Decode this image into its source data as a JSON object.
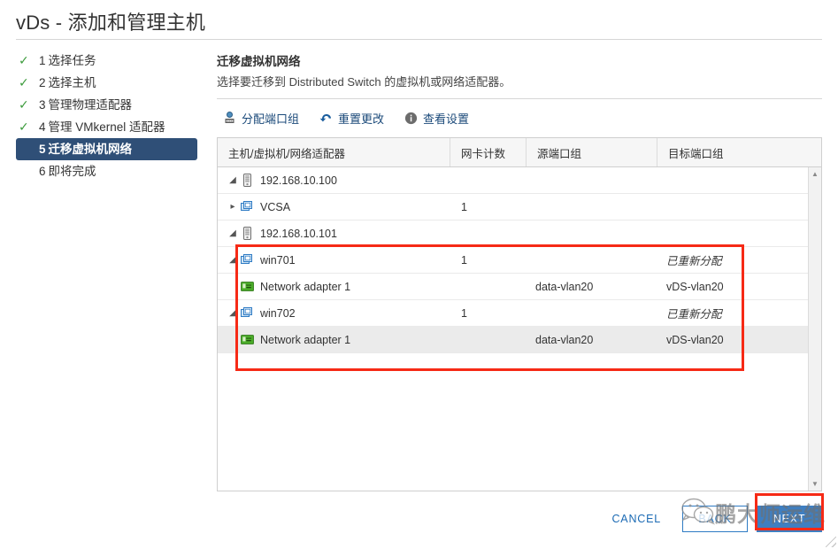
{
  "window": {
    "title": "vDs - 添加和管理主机"
  },
  "steps": [
    {
      "num": "1",
      "label": "选择任务",
      "done": true,
      "active": false
    },
    {
      "num": "2",
      "label": "选择主机",
      "done": true,
      "active": false
    },
    {
      "num": "3",
      "label": "管理物理适配器",
      "done": true,
      "active": false
    },
    {
      "num": "4",
      "label": "管理 VMkernel 适配器",
      "done": true,
      "active": false
    },
    {
      "num": "5",
      "label": "迁移虚拟机网络",
      "done": false,
      "active": true
    },
    {
      "num": "6",
      "label": "即将完成",
      "done": false,
      "active": false
    }
  ],
  "content": {
    "heading": "迁移虚拟机网络",
    "subheading": "选择要迁移到 Distributed Switch 的虚拟机或网络适配器。"
  },
  "toolbar": {
    "assign_port_group": "分配端口组",
    "reset_changes": "重置更改",
    "view_settings": "查看设置",
    "icons": [
      "assign-port-group-icon",
      "undo-icon",
      "info-icon"
    ]
  },
  "table": {
    "columns": [
      "主机/虚拟机/网络适配器",
      "网卡计数",
      "源端口组",
      "目标端口组"
    ],
    "rows": [
      {
        "name": "192.168.10.100",
        "icon": "host-icon",
        "indent": 0,
        "twisty": "open",
        "nics": "",
        "source": "",
        "target": "",
        "selected": false,
        "italic": false
      },
      {
        "name": "VCSA",
        "icon": "vm-icon",
        "indent": 1,
        "twisty": "closed",
        "nics": "1",
        "source": "",
        "target": "",
        "selected": false,
        "italic": false
      },
      {
        "name": "192.168.10.101",
        "icon": "host-icon",
        "indent": 0,
        "twisty": "open",
        "nics": "",
        "source": "",
        "target": "",
        "selected": false,
        "italic": false
      },
      {
        "name": "win701",
        "icon": "vm-icon",
        "indent": 1,
        "twisty": "open",
        "nics": "1",
        "source": "",
        "target": "已重新分配",
        "selected": false,
        "italic": true
      },
      {
        "name": "Network adapter 1",
        "icon": "nic-icon",
        "indent": 2,
        "twisty": "none",
        "nics": "",
        "source": "data-vlan20",
        "target": "vDS-vlan20",
        "selected": false,
        "italic": false
      },
      {
        "name": "win702",
        "icon": "vm-icon",
        "indent": 1,
        "twisty": "open",
        "nics": "1",
        "source": "",
        "target": "已重新分配",
        "selected": false,
        "italic": true
      },
      {
        "name": "Network adapter 1",
        "icon": "nic-icon",
        "indent": 2,
        "twisty": "none",
        "nics": "",
        "source": "data-vlan20",
        "target": "vDS-vlan20",
        "selected": true,
        "italic": false
      }
    ]
  },
  "footer": {
    "cancel": "CANCEL",
    "back": "BACK",
    "next": "NEXT"
  },
  "watermark": {
    "text": "鹏大师运维",
    "logo": "wechat-icon"
  },
  "annotations": {
    "rows_highlight": "red-highlight-box-rows",
    "next_highlight": "red-highlight-box-next-button"
  },
  "colors": {
    "active_step_bg": "#2f4f77",
    "check_green": "#3c9b3c",
    "primary_button": "#3f7fc1",
    "link_blue": "#1b6ab4",
    "annotation_red": "#f62a16",
    "nic_green": "#4caf2a",
    "vm_blue": "#2e7bc4"
  }
}
